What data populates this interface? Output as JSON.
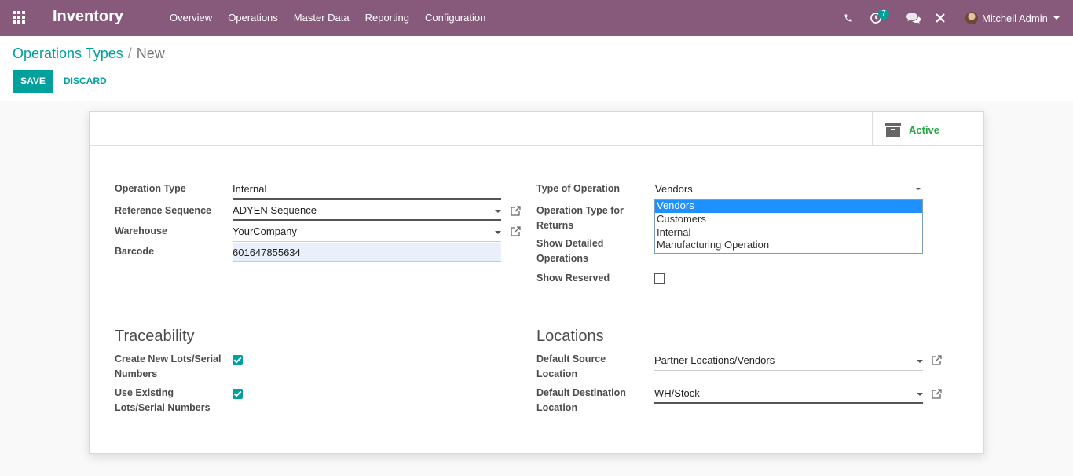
{
  "navbar": {
    "brand": "Inventory",
    "menu": [
      "Overview",
      "Operations",
      "Master Data",
      "Reporting",
      "Configuration"
    ],
    "notification_count": "7",
    "user": "Mitchell Admin"
  },
  "control_panel": {
    "breadcrumb_parent": "Operations Types",
    "breadcrumb_separator": "/",
    "breadcrumb_current": "New",
    "save_label": "SAVE",
    "discard_label": "DISCARD"
  },
  "sheet": {
    "active_label": "Active",
    "left": {
      "operation_type_label": "Operation Type",
      "operation_type_value": "Internal",
      "reference_sequence_label": "Reference Sequence",
      "reference_sequence_value": "ADYEN Sequence",
      "warehouse_label": "Warehouse",
      "warehouse_value": "YourCompany",
      "barcode_label": "Barcode",
      "barcode_value": "601647855634"
    },
    "right": {
      "type_of_operation_label": "Type of Operation",
      "type_of_operation_value": "Vendors",
      "type_of_operation_options": [
        "Vendors",
        "Customers",
        "Internal",
        "Manufacturing Operation"
      ],
      "return_type_label_1": "Operation Type for",
      "return_type_label_2": "Returns",
      "show_detailed_label_1": "Show Detailed",
      "show_detailed_label_2": "Operations",
      "show_reserved_label": "Show Reserved",
      "show_reserved_checked": false
    },
    "traceability": {
      "title": "Traceability",
      "create_lots_label_1": "Create New Lots/Serial",
      "create_lots_label_2": "Numbers",
      "create_lots_checked": true,
      "use_existing_label_1": "Use Existing",
      "use_existing_label_2": "Lots/Serial Numbers",
      "use_existing_checked": true
    },
    "locations": {
      "title": "Locations",
      "default_source_label_1": "Default Source",
      "default_source_label_2": "Location",
      "default_source_value": "Partner Locations/Vendors",
      "default_dest_label_1": "Default Destination",
      "default_dest_label_2": "Location",
      "default_dest_value": "WH/Stock"
    }
  },
  "colors": {
    "navbar": "#875a7b",
    "primary": "#00a09d",
    "active_green": "#28a745",
    "selected_option": "#1e90ff"
  },
  "icons": [
    "apps-grid-icon",
    "phone-icon",
    "activity-clock-icon",
    "chat-icon",
    "close-cross-icon",
    "caret-down-icon",
    "archive-box-icon",
    "external-link-icon"
  ]
}
